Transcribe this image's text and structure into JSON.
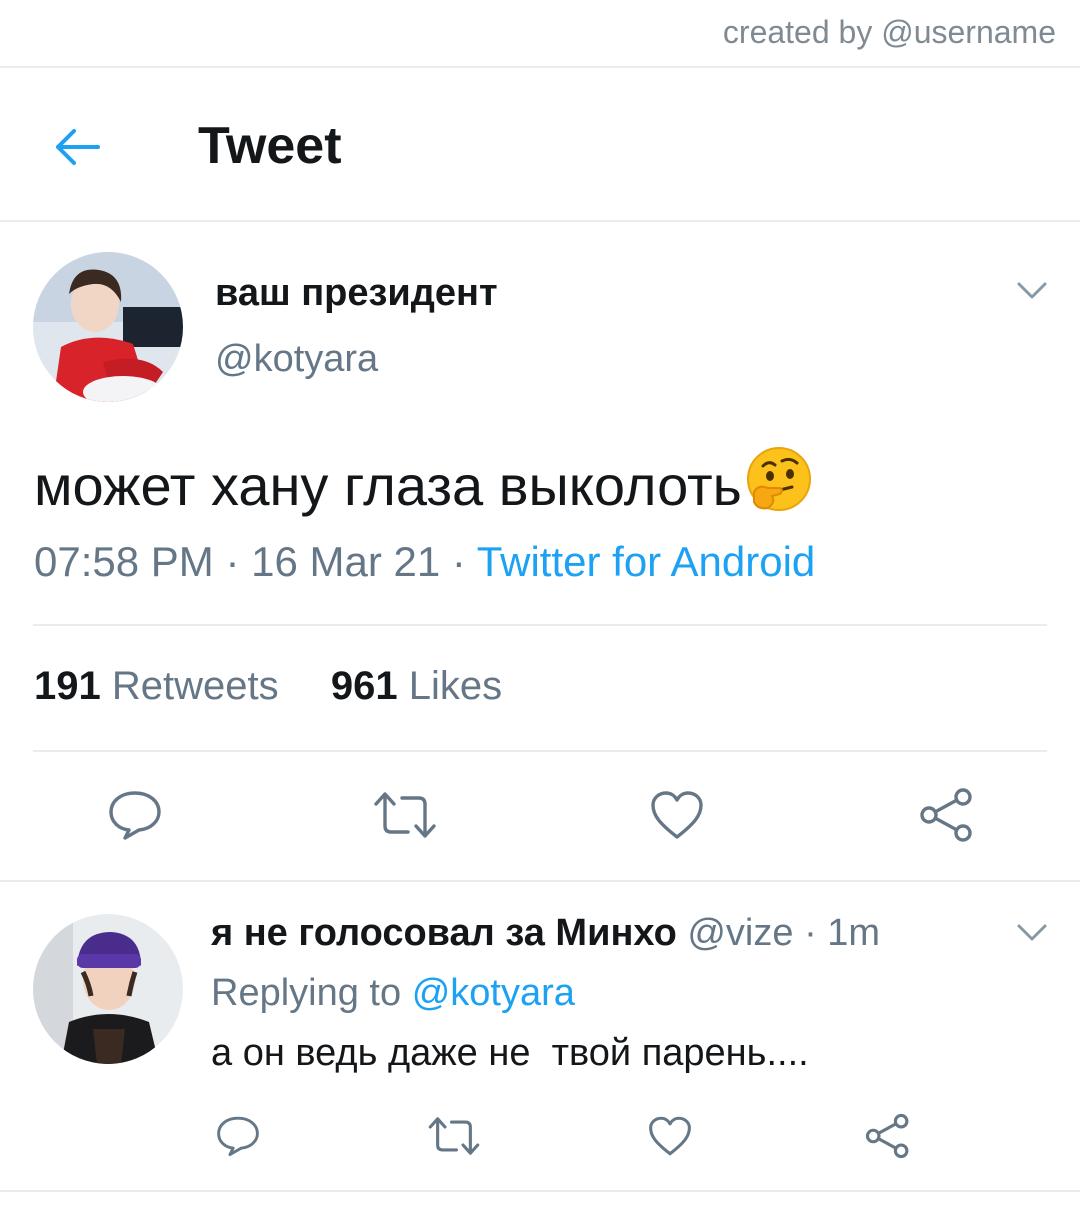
{
  "credit": "created by @username",
  "header": {
    "title": "Tweet"
  },
  "tweet": {
    "author_name": "ваш президент",
    "author_handle": "@kotyara",
    "text": "может хану глаза выколоть",
    "emoji_icon": "thinking-face-emoji",
    "time": "07:58 PM",
    "date": "16 Mar 21",
    "source": "Twitter for Android",
    "retweets_count": "191",
    "retweets_label": "Retweets",
    "likes_count": "961",
    "likes_label": "Likes"
  },
  "reply": {
    "author_name": "я не голосовал за Минхо",
    "author_handle": "@vize",
    "time": "1m",
    "replying_prefix": "Replying to",
    "replying_handle": "@kotyara",
    "text": "а он ведь даже не  твой парень...."
  },
  "colors": {
    "accent": "#1da1f2",
    "secondary_text": "#657786",
    "icon_gray": "#657786",
    "divider": "#e6ecf0"
  }
}
